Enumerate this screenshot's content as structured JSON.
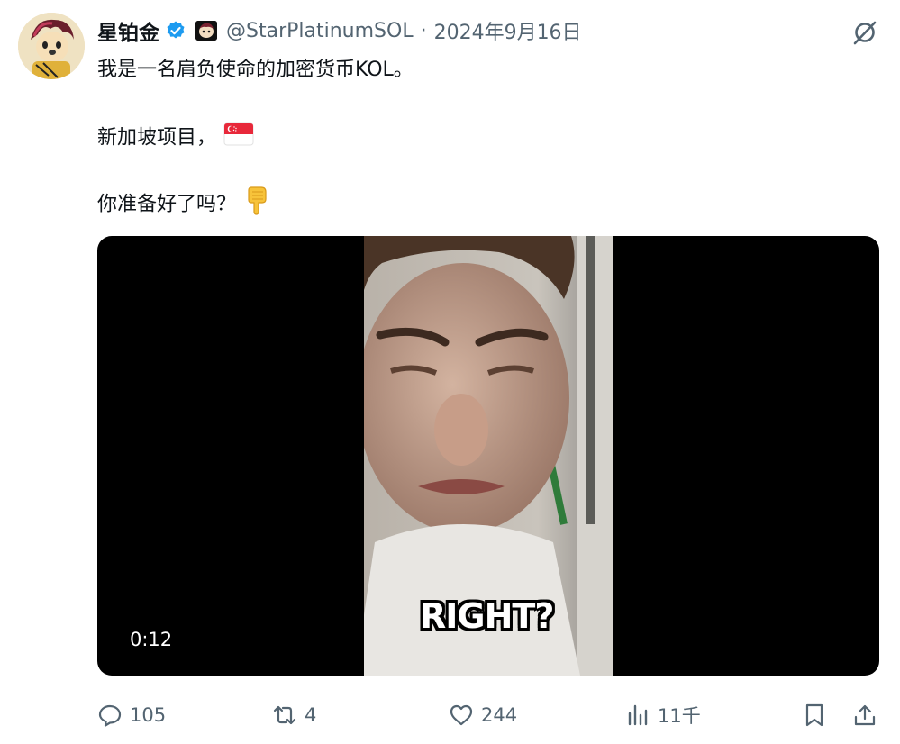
{
  "author": {
    "name": "星铂金",
    "handle": "@StarPlatinumSOL",
    "separator": "·",
    "date": "2024年9月16日"
  },
  "post": {
    "line1": "我是一名肩负使命的加密货币KOL。",
    "line2": "新加坡项目，",
    "line3": "你准备好了吗？",
    "emoji_flag": "singapore-flag-icon",
    "emoji_hand": "backhand-index-pointing-down-icon"
  },
  "video": {
    "time": "0:12",
    "caption": "RIGHT?"
  },
  "actions": {
    "replies": "105",
    "reposts": "4",
    "likes": "244",
    "views": "11千"
  },
  "colors": {
    "text": "#0f1419",
    "muted": "#536471",
    "verified": "#1d9bf0"
  }
}
